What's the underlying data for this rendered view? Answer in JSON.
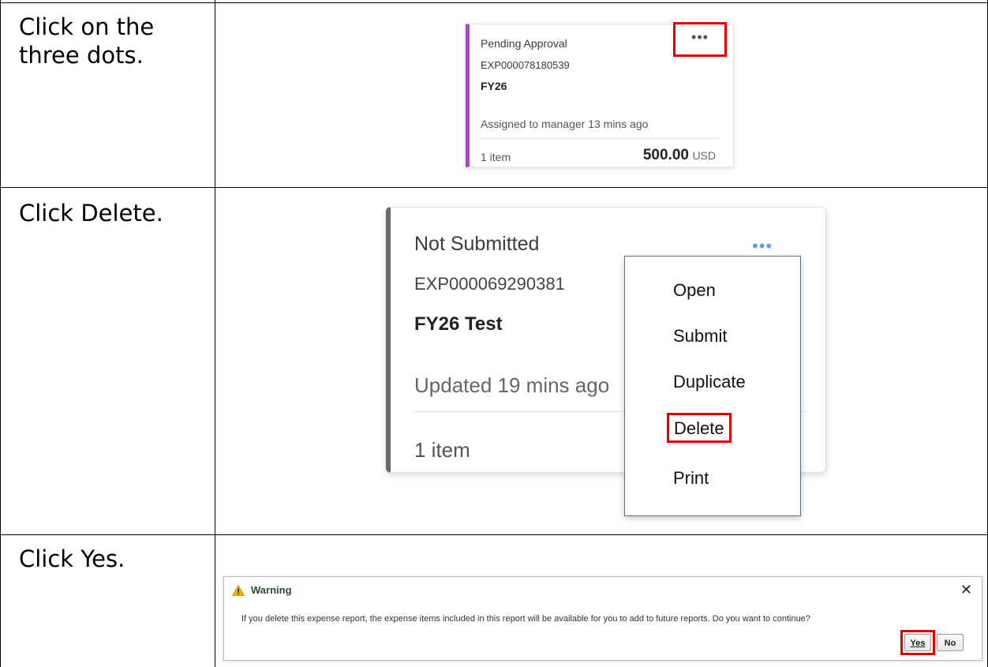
{
  "steps": [
    {
      "instruction": "Click on the three dots."
    },
    {
      "instruction": "Click Delete."
    },
    {
      "instruction": "Click Yes."
    }
  ],
  "card_pending": {
    "status": "Pending Approval",
    "report_id": "EXP000078180539",
    "name": "FY26",
    "activity": "Assigned to manager 13 mins ago",
    "item_count": "1 item",
    "amount": "500.00",
    "currency": "USD",
    "menu_icon": "more-horizontal-icon",
    "accent_color": "#a349c9"
  },
  "card_not_submitted": {
    "status": "Not Submitted",
    "report_id": "EXP000069290381",
    "name": "FY26 Test",
    "activity": "Updated 19 mins ago",
    "item_count": "1 item",
    "menu_icon": "more-horizontal-icon",
    "accent_color": "#6a6a6a"
  },
  "context_menu": {
    "items": [
      "Open",
      "Submit",
      "Duplicate",
      "Delete",
      "Print"
    ]
  },
  "warning_dialog": {
    "title": "Warning",
    "icon": "warning-triangle-icon",
    "close_icon": "close-icon",
    "message": "If you delete this expense report, the expense items included in this report will be available for you to add to future reports. Do you want to continue?",
    "yes_label": "Yes",
    "no_label": "No"
  },
  "highlight_color": "#e00000"
}
